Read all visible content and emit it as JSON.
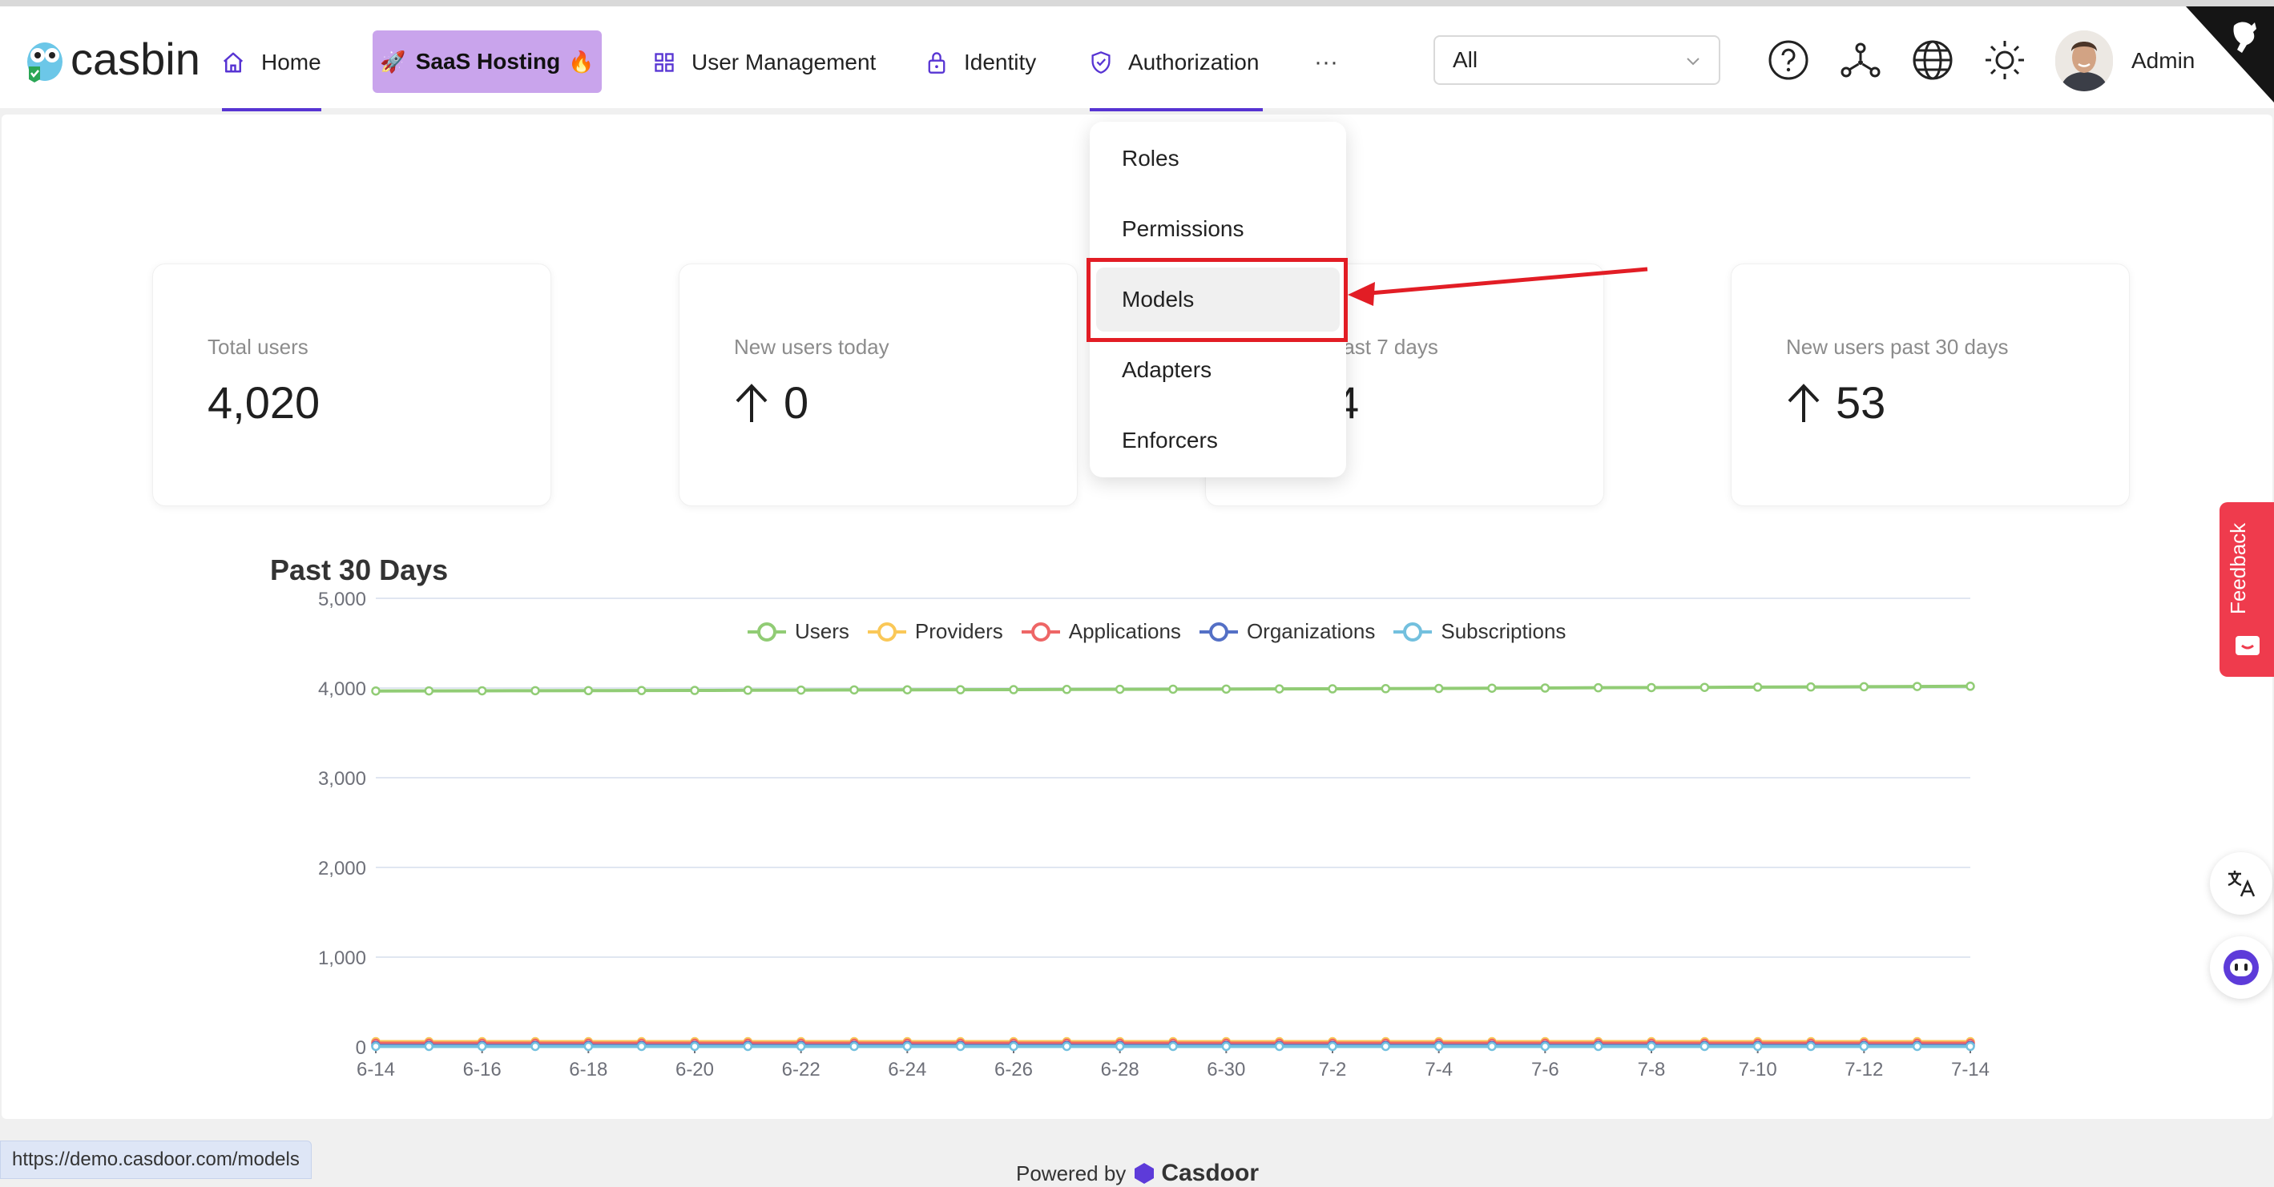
{
  "header": {
    "logo_text": "casbin",
    "nav": {
      "home": "Home",
      "saas": "SaaS Hosting",
      "user_management": "User Management",
      "identity": "Identity",
      "authorization": "Authorization",
      "more": "···"
    },
    "org_select": {
      "value": "All"
    },
    "icons": [
      "help-icon",
      "network-icon",
      "globe-icon",
      "sun-icon"
    ],
    "user_name": "Admin",
    "accent_color": "#5734d3",
    "saas_bg": "#c9a4ec"
  },
  "authorization_menu": {
    "items": [
      "Roles",
      "Permissions",
      "Models",
      "Adapters",
      "Enforcers"
    ],
    "active": "Models"
  },
  "stats": [
    {
      "title": "Total users",
      "value": "4,020",
      "arrow": false
    },
    {
      "title": "New users today",
      "value": "0",
      "arrow": true
    },
    {
      "title": "rs past 7 days",
      "value": "4",
      "arrow": false
    },
    {
      "title": "New users past 30 days",
      "value": "53",
      "arrow": true
    }
  ],
  "chart_data": {
    "type": "line",
    "title": "Past 30 Days",
    "x": [
      "6-14",
      "6-15",
      "6-16",
      "6-17",
      "6-18",
      "6-19",
      "6-20",
      "6-21",
      "6-22",
      "6-23",
      "6-24",
      "6-25",
      "6-26",
      "6-27",
      "6-28",
      "6-29",
      "6-30",
      "7-1",
      "7-2",
      "7-3",
      "7-4",
      "7-5",
      "7-6",
      "7-7",
      "7-8",
      "7-9",
      "7-10",
      "7-11",
      "7-12",
      "7-13",
      "7-14"
    ],
    "x_tick_labels": [
      "6-14",
      "6-16",
      "6-18",
      "6-20",
      "6-22",
      "6-24",
      "6-26",
      "6-28",
      "6-30",
      "7-2",
      "7-4",
      "7-6",
      "7-8",
      "7-10",
      "7-12",
      "7-14"
    ],
    "y_ticks": [
      "0",
      "1,000",
      "2,000",
      "3,000",
      "4,000",
      "5,000"
    ],
    "ylim": [
      0,
      5000
    ],
    "legend_position": "top-center",
    "series": [
      {
        "name": "Users",
        "color": "#91cc75",
        "values": [
          3967,
          3968,
          3969,
          3970,
          3971,
          3972,
          3973,
          3975,
          3977,
          3979,
          3980,
          3981,
          3982,
          3984,
          3986,
          3987,
          3988,
          3990,
          3991,
          3993,
          3995,
          3998,
          4000,
          4003,
          4005,
          4007,
          4010,
          4012,
          4014,
          4017,
          4020
        ]
      },
      {
        "name": "Providers",
        "color": "#fac858",
        "values": [
          58,
          58,
          58,
          58,
          58,
          58,
          58,
          58,
          58,
          58,
          58,
          58,
          58,
          58,
          58,
          58,
          58,
          58,
          58,
          58,
          58,
          58,
          58,
          58,
          58,
          58,
          58,
          58,
          58,
          58,
          58
        ]
      },
      {
        "name": "Applications",
        "color": "#ee6666",
        "values": [
          40,
          40,
          40,
          40,
          40,
          40,
          40,
          40,
          40,
          40,
          40,
          40,
          40,
          40,
          40,
          40,
          40,
          40,
          40,
          40,
          40,
          40,
          40,
          40,
          40,
          40,
          40,
          40,
          40,
          40,
          40
        ]
      },
      {
        "name": "Organizations",
        "color": "#5470c6",
        "values": [
          15,
          15,
          15,
          15,
          15,
          15,
          15,
          15,
          15,
          15,
          15,
          15,
          15,
          15,
          15,
          15,
          15,
          15,
          15,
          15,
          15,
          15,
          15,
          15,
          15,
          15,
          15,
          15,
          15,
          15,
          15
        ]
      },
      {
        "name": "Subscriptions",
        "color": "#73c0de",
        "values": [
          5,
          5,
          5,
          5,
          5,
          5,
          5,
          5,
          5,
          5,
          5,
          5,
          5,
          5,
          5,
          5,
          5,
          5,
          5,
          5,
          5,
          5,
          5,
          5,
          5,
          5,
          5,
          5,
          5,
          5,
          5
        ]
      }
    ]
  },
  "side": {
    "feedback": "Feedback"
  },
  "footer": {
    "status_url": "https://demo.casdoor.com/models",
    "powered_by": "Powered by",
    "brand": "Casdoor"
  }
}
